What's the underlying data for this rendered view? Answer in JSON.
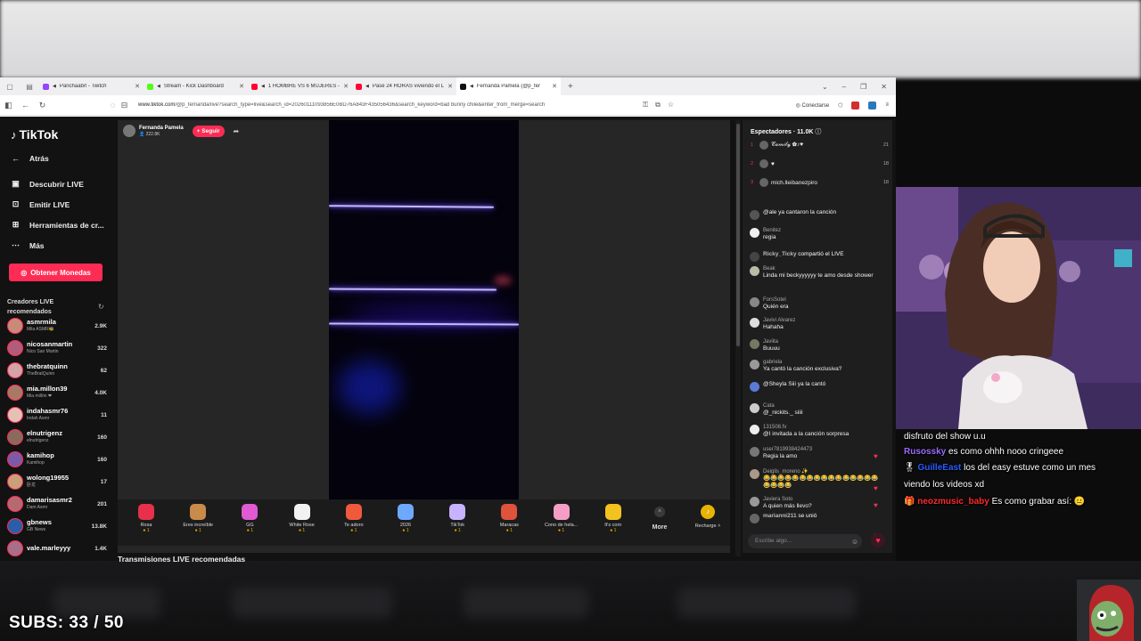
{
  "browser": {
    "tabs": [
      {
        "title": "Panchaabrl - Twitch",
        "color": "#9146ff"
      },
      {
        "title": "Stream - Kick Dashboard",
        "color": "#53fc18"
      },
      {
        "title": "1 HOMBRE VS 6 MUJERES - You",
        "color": "#ff0033"
      },
      {
        "title": "Pasé 24 HORAS viviendo el LUJO",
        "color": "#ff0033"
      },
      {
        "title": "Fernanda Pamela (@p_fer",
        "color": "#111111"
      }
    ],
    "url_domain": "www.tiktok.com",
    "url_path": "/@p_fernanda/live?search_type=live&search_id=20260111093856E0BD76A843F435056436&search_keyword=bad bunny chile&enter_from_merge=search",
    "connect_label": "Conectarse"
  },
  "tiktok": {
    "logo": "TikTok",
    "nav": [
      {
        "label": "Atrás",
        "icon": "back-arrow-icon"
      },
      {
        "label": "Descubrir LIVE",
        "icon": "live-discover-icon"
      },
      {
        "label": "Emitir LIVE",
        "icon": "broadcast-icon"
      },
      {
        "label": "Herramientas de cr...",
        "icon": "tools-icon"
      },
      {
        "label": "Más",
        "icon": "more-dots-icon"
      }
    ],
    "coins_button": "Obtener Monedas",
    "creators_heading": "Creadores LIVE recomendados",
    "creators": [
      {
        "name": "asmrmila",
        "sub": "Mila ASMR🐝",
        "count": "2.9K"
      },
      {
        "name": "nicosanmartin",
        "sub": "Nico San Martin",
        "count": "322"
      },
      {
        "name": "thebratquinn",
        "sub": "TheBratQuinn",
        "count": "62"
      },
      {
        "name": "mia.millon39",
        "sub": "Mia millón ❤",
        "count": "4.0K"
      },
      {
        "name": "indahasmr76",
        "sub": "Indah Asmr",
        "count": "11"
      },
      {
        "name": "elnutrigenz",
        "sub": "elnutrigenz",
        "count": "160"
      },
      {
        "name": "kamihop",
        "sub": "Kamihop",
        "count": "160"
      },
      {
        "name": "wolong19955",
        "sub": "卧龙",
        "count": "17"
      },
      {
        "name": "damarisasmr2",
        "sub": "Dam Asmr",
        "count": "201"
      },
      {
        "name": "gbnews",
        "sub": "GB News",
        "count": "13.8K"
      },
      {
        "name": "vale.marleyyy",
        "sub": "",
        "count": "1.4K"
      }
    ],
    "host": {
      "name": "Fernanda Pamela",
      "followers": "222.8K",
      "follow_label": "+ Seguir"
    },
    "gifts": [
      {
        "label": "Rosa",
        "price": "1",
        "color": "#e8304a"
      },
      {
        "label": "Eres increíble",
        "price": "1",
        "color": "#c98a4a"
      },
      {
        "label": "GG",
        "price": "1",
        "color": "#e15ad1"
      },
      {
        "label": "White Rose",
        "price": "1",
        "color": "#f2f2f2"
      },
      {
        "label": "Te adoro",
        "price": "1",
        "color": "#f05a3c"
      },
      {
        "label": "2026",
        "price": "1",
        "color": "#6fa8ff"
      },
      {
        "label": "TikTok",
        "price": "1",
        "color": "#c7b3ff"
      },
      {
        "label": "Maracas",
        "price": "1",
        "color": "#e0523c"
      },
      {
        "label": "Cono de hela...",
        "price": "1",
        "color": "#f59ec5"
      },
      {
        "label": "It's corn",
        "price": "1",
        "color": "#f2c21e"
      }
    ],
    "more_label": "More",
    "recharge_label": "Recharge",
    "recommended_title": "Transmisiones LIVE recomendadas",
    "viewers_heading": "Espectadores · 11.0K",
    "top_viewers": [
      {
        "rank": "1",
        "name": "𝒞𝒶𝓂𝒾𝓁𝓎 ✿♪♥",
        "score": "21"
      },
      {
        "rank": "2",
        "name": "♥",
        "score": "18"
      },
      {
        "rank": "3",
        "name": "mich.lleibanezpiro",
        "score": "18"
      }
    ],
    "messages": [
      {
        "user": "",
        "text": "@ale ya cantaron la canción"
      },
      {
        "user": "Benitez",
        "text": "regia"
      },
      {
        "user": "Ricky_Ticky",
        "text": "compartió el LIVE",
        "inline": true
      },
      {
        "user": "Beak",
        "text": "Linda mi beckyyyyyy te amo desde shower"
      },
      {
        "user": "ForsSotel",
        "text": "Quién era"
      },
      {
        "user": "Javivi Alvarez",
        "text": "Hahaha"
      },
      {
        "user": "Javiita",
        "text": "Buuuu"
      },
      {
        "user": "gabriela",
        "text": "Ya cantó la canción exclusiva?"
      },
      {
        "user": "",
        "text": "@Sheyla Siii ya la cantó"
      },
      {
        "user": "Cata",
        "text": "@_nickits._ siiii"
      },
      {
        "user": "131508.fv",
        "text": "@I invitada a la canción sorpresa"
      },
      {
        "user": "user7819938424473",
        "text": "Regia la amo"
      },
      {
        "user": "Deiglis_moreno ✨",
        "text": "😂😂😂😂😂😂😂😂😂😂😂😂😂😂😂😂😂😂😂😂"
      },
      {
        "user": "Javiera Soto",
        "text": "A quien más llevo?"
      },
      {
        "user": "marianni211",
        "text": "se unió",
        "inline": true
      }
    ],
    "chat_placeholder": "Escribe algo..."
  },
  "stream_overlay": {
    "chat_lines": [
      {
        "user": "",
        "text": "disfruto del show u.u"
      },
      {
        "user": "Rusossky",
        "text": "es como ohhh nooo cringeee"
      },
      {
        "user": "GuilleEast",
        "text": "los del easy estuve como un mes"
      },
      {
        "user": "",
        "text": "viendo los videos xd"
      },
      {
        "user": "neozmusic_baby",
        "text": "Es como grabar así: 😐"
      }
    ],
    "subs_label": "SUBS: 33 / 50"
  }
}
